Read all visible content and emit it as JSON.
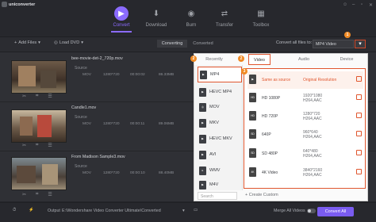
{
  "app": {
    "name": "uniconverter"
  },
  "nav": [
    {
      "label": "Convert"
    },
    {
      "label": "Download"
    },
    {
      "label": "Burn"
    },
    {
      "label": "Transfer"
    },
    {
      "label": "Toolbox"
    }
  ],
  "toolbar": {
    "add_files": "Add Files",
    "load_dvd": "Load DVD",
    "tab_converting": "Converting",
    "tab_converted": "Converted",
    "convert_all_to_label": "Convert all files to:",
    "convert_all_to_value": "MP4 Video"
  },
  "files": [
    {
      "name": "bee-movie-det-2_720p.mov",
      "source": "Source",
      "fmt": "MOV",
      "res": "1280*720",
      "dur": "00:00:02",
      "size": "86.33MB"
    },
    {
      "name": "Candle1.mov",
      "source": "Source",
      "fmt": "MOV",
      "res": "1280*720",
      "dur": "00:00:11",
      "size": "89.06MB"
    },
    {
      "name": "From Madison Sample3.mov",
      "source": "Source",
      "fmt": "MOV",
      "res": "1280*720",
      "dur": "00:00:10",
      "size": "88.40MB"
    }
  ],
  "panel": {
    "tabs": [
      "Recently",
      "Video",
      "Audio",
      "Device"
    ],
    "formats": [
      "MP4",
      "HEVC MP4",
      "MOV",
      "MKV",
      "HEVC MKV",
      "AVI",
      "WMV",
      "M4V"
    ],
    "search_placeholder": "Search",
    "create_custom": "+ Create Custom",
    "resolutions": [
      {
        "name": "Same as source",
        "detail": "Original Resolution",
        "detail2": ""
      },
      {
        "name": "HD 1080P",
        "detail": "1920*1080",
        "detail2": "H264,AAC"
      },
      {
        "name": "HD 720P",
        "detail": "1280*720",
        "detail2": "H264,AAC"
      },
      {
        "name": "640P",
        "detail": "960*640",
        "detail2": "H264,AAC"
      },
      {
        "name": "SD 480P",
        "detail": "640*480",
        "detail2": "H264,AAC"
      },
      {
        "name": "4K Video",
        "detail": "3840*2160",
        "detail2": "H264,AAC"
      }
    ]
  },
  "badges": [
    "1",
    "2",
    "3"
  ],
  "bottom": {
    "output_label": "Output",
    "output_path": "E:\\Wondershare Video Converter Ultimate\\Converted",
    "merge_label": "Merge All Videos",
    "convert_all": "Convert All"
  },
  "colors": {
    "accent": "#7a5cf0",
    "highlight": "#e0562e",
    "badge": "#f08a24"
  }
}
